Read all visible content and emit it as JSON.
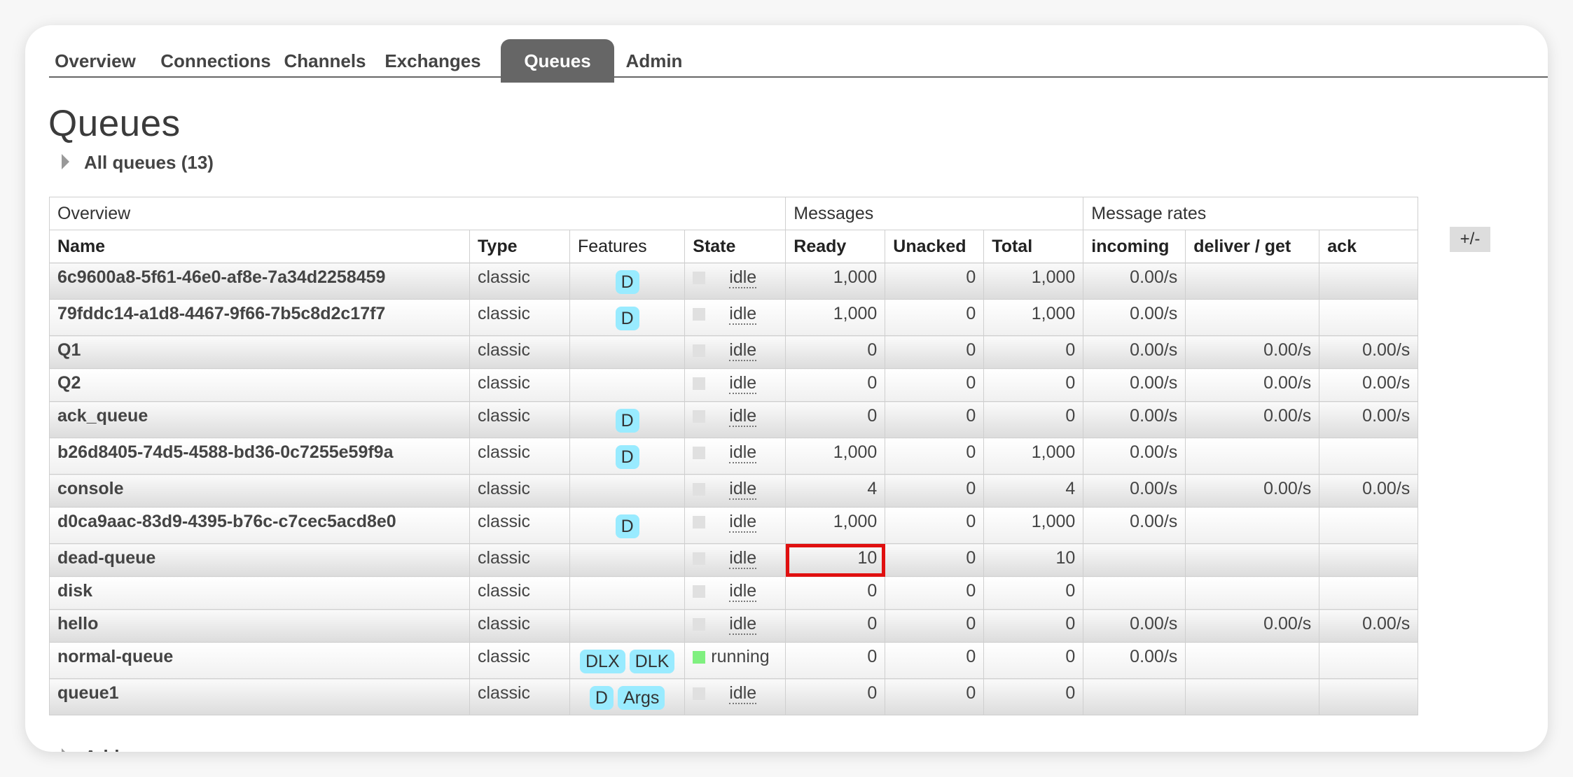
{
  "tabs": [
    {
      "label": "Overview"
    },
    {
      "label": "Connections"
    },
    {
      "label": "Channels"
    },
    {
      "label": "Exchanges"
    },
    {
      "label": "Queues",
      "active": true
    },
    {
      "label": "Admin"
    }
  ],
  "page_title": "Queues",
  "section_toggle": "All queues (13)",
  "add_toggle": "Add a new queue",
  "columns_toggle": "+/-",
  "table": {
    "groups": {
      "overview": "Overview",
      "messages": "Messages",
      "rates": "Message rates"
    },
    "headers": {
      "name": "Name",
      "type": "Type",
      "features": "Features",
      "state": "State",
      "ready": "Ready",
      "unacked": "Unacked",
      "total": "Total",
      "incoming": "incoming",
      "deliver_get": "deliver / get",
      "ack": "ack"
    },
    "rows": [
      {
        "name": "6c9600a8-5f61-46e0-af8e-7a34d2258459",
        "type": "classic",
        "f1": "D",
        "f2": "",
        "state": "idle",
        "ready": "1,000",
        "unacked": "0",
        "total": "1,000",
        "incoming": "0.00/s",
        "deliver_get": "",
        "ack": ""
      },
      {
        "name": "79fddc14-a1d8-4467-9f66-7b5c8d2c17f7",
        "type": "classic",
        "f1": "D",
        "f2": "",
        "state": "idle",
        "ready": "1,000",
        "unacked": "0",
        "total": "1,000",
        "incoming": "0.00/s",
        "deliver_get": "",
        "ack": ""
      },
      {
        "name": "Q1",
        "type": "classic",
        "f1": "",
        "f2": "",
        "state": "idle",
        "ready": "0",
        "unacked": "0",
        "total": "0",
        "incoming": "0.00/s",
        "deliver_get": "0.00/s",
        "ack": "0.00/s"
      },
      {
        "name": "Q2",
        "type": "classic",
        "f1": "",
        "f2": "",
        "state": "idle",
        "ready": "0",
        "unacked": "0",
        "total": "0",
        "incoming": "0.00/s",
        "deliver_get": "0.00/s",
        "ack": "0.00/s"
      },
      {
        "name": "ack_queue",
        "type": "classic",
        "f1": "D",
        "f2": "",
        "state": "idle",
        "ready": "0",
        "unacked": "0",
        "total": "0",
        "incoming": "0.00/s",
        "deliver_get": "0.00/s",
        "ack": "0.00/s"
      },
      {
        "name": "b26d8405-74d5-4588-bd36-0c7255e59f9a",
        "type": "classic",
        "f1": "D",
        "f2": "",
        "state": "idle",
        "ready": "1,000",
        "unacked": "0",
        "total": "1,000",
        "incoming": "0.00/s",
        "deliver_get": "",
        "ack": ""
      },
      {
        "name": "console",
        "type": "classic",
        "f1": "",
        "f2": "",
        "state": "idle",
        "ready": "4",
        "unacked": "0",
        "total": "4",
        "incoming": "0.00/s",
        "deliver_get": "0.00/s",
        "ack": "0.00/s"
      },
      {
        "name": "d0ca9aac-83d9-4395-b76c-c7cec5acd8e0",
        "type": "classic",
        "f1": "D",
        "f2": "",
        "state": "idle",
        "ready": "1,000",
        "unacked": "0",
        "total": "1,000",
        "incoming": "0.00/s",
        "deliver_get": "",
        "ack": ""
      },
      {
        "name": "dead-queue",
        "type": "classic",
        "f1": "",
        "f2": "",
        "state": "idle",
        "ready": "10",
        "unacked": "0",
        "total": "10",
        "incoming": "",
        "deliver_get": "",
        "ack": ""
      },
      {
        "name": "disk",
        "type": "classic",
        "f1": "",
        "f2": "",
        "state": "idle",
        "ready": "0",
        "unacked": "0",
        "total": "0",
        "incoming": "",
        "deliver_get": "",
        "ack": ""
      },
      {
        "name": "hello",
        "type": "classic",
        "f1": "",
        "f2": "",
        "state": "idle",
        "ready": "0",
        "unacked": "0",
        "total": "0",
        "incoming": "0.00/s",
        "deliver_get": "0.00/s",
        "ack": "0.00/s"
      },
      {
        "name": "normal-queue",
        "type": "classic",
        "f1": "DLX",
        "f2": "DLK",
        "state": "running",
        "ready": "0",
        "unacked": "0",
        "total": "0",
        "incoming": "0.00/s",
        "deliver_get": "",
        "ack": ""
      },
      {
        "name": "queue1",
        "type": "classic",
        "f1": "D",
        "f2": "Args",
        "state": "idle",
        "ready": "0",
        "unacked": "0",
        "total": "0",
        "incoming": "",
        "deliver_get": "",
        "ack": ""
      }
    ]
  },
  "colors": {
    "tab_active_bg": "#666666",
    "badge_bg": "#99ebff",
    "running": "#80f080",
    "highlight": "#e01010"
  }
}
